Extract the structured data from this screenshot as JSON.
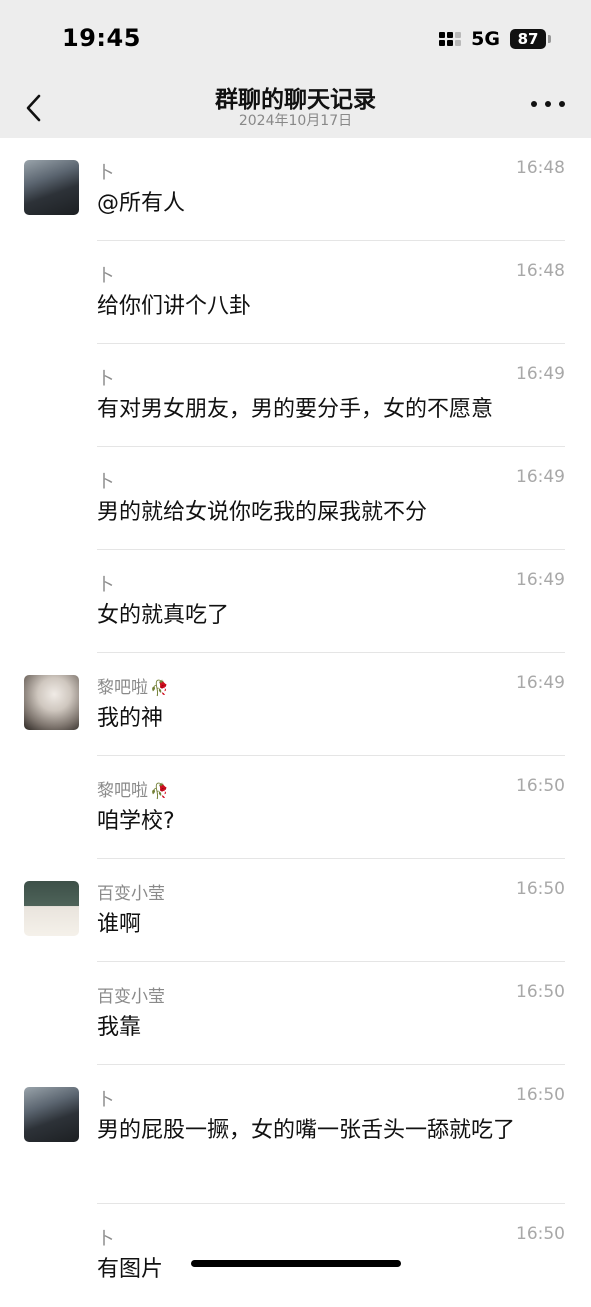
{
  "status": {
    "time": "19:45",
    "network": "5G",
    "battery": "87"
  },
  "nav": {
    "title": "群聊的聊天记录",
    "subtitle": "2024年10月17日"
  },
  "messages": [
    {
      "sender": "卜",
      "time": "16:48",
      "text": "@所有人",
      "avatar": "car"
    },
    {
      "sender": "卜",
      "time": "16:48",
      "text": "给你们讲个八卦",
      "avatar": ""
    },
    {
      "sender": "卜",
      "time": "16:49",
      "text": "有对男女朋友，男的要分手，女的不愿意",
      "avatar": ""
    },
    {
      "sender": "卜",
      "time": "16:49",
      "text": "男的就给女说你吃我的屎我就不分",
      "avatar": ""
    },
    {
      "sender": "卜",
      "time": "16:49",
      "text": "女的就真吃了",
      "avatar": ""
    },
    {
      "sender": "黎吧啦",
      "time": "16:49",
      "text": "我的神",
      "avatar": "girl1",
      "emoji": "🥀"
    },
    {
      "sender": "黎吧啦",
      "time": "16:50",
      "text": "咱学校?",
      "avatar": "",
      "emoji": "🥀"
    },
    {
      "sender": "百变小莹",
      "time": "16:50",
      "text": "谁啊",
      "avatar": "girl2"
    },
    {
      "sender": "百变小莹",
      "time": "16:50",
      "text": "我靠",
      "avatar": ""
    },
    {
      "sender": "卜",
      "time": "16:50",
      "text": "男的屁股一撅，女的嘴一张舌头一舔就吃了",
      "avatar": "car"
    },
    {
      "sender": "卜",
      "time": "16:50",
      "text": "有图片",
      "avatar": ""
    }
  ]
}
